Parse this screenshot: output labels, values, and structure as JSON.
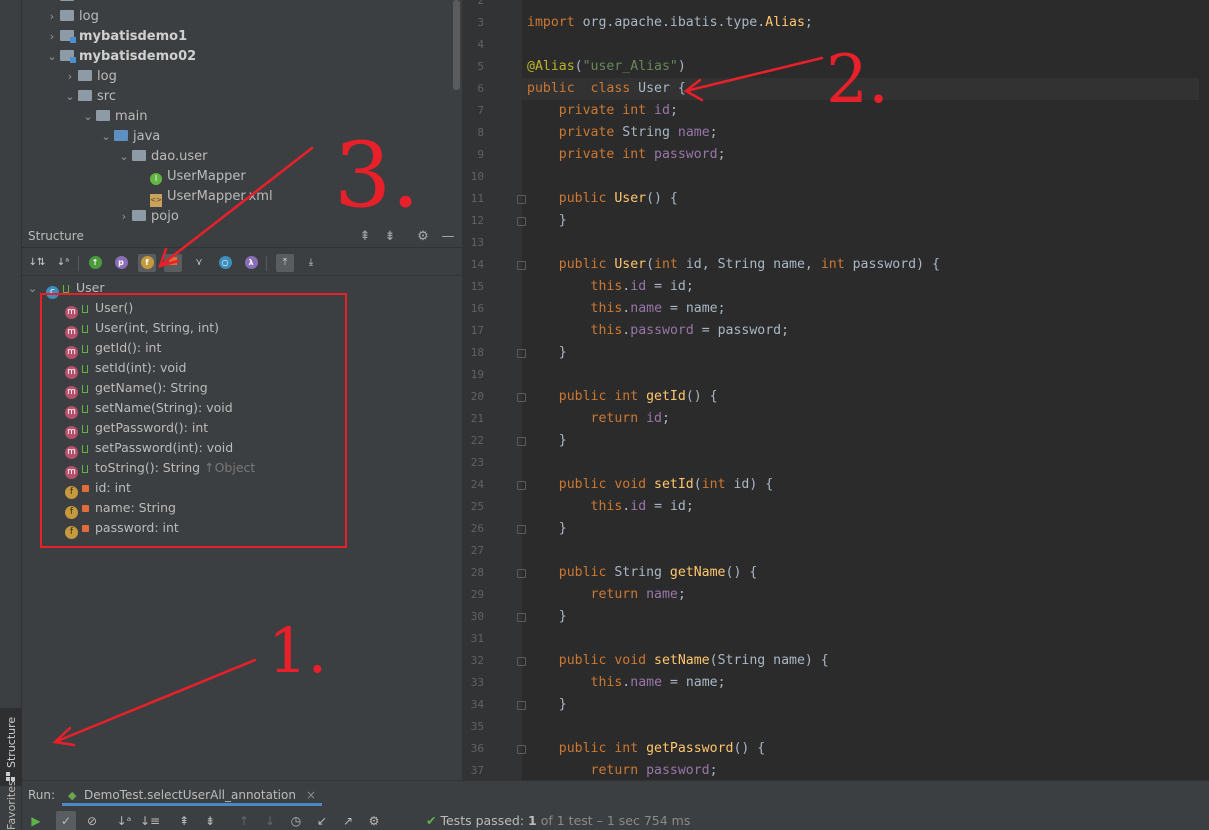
{
  "side_tabs": {
    "structure": "Structure",
    "favorites": "Favorites"
  },
  "project_tree": [
    {
      "label": "idea",
      "indent": 1,
      "chevron": "›",
      "icon": "folder"
    },
    {
      "label": "log",
      "indent": 1,
      "chevron": "›",
      "icon": "folder"
    },
    {
      "label": "mybatisdemo1",
      "indent": 1,
      "chevron": "›",
      "icon": "module",
      "bold": true
    },
    {
      "label": "mybatisdemo02",
      "indent": 1,
      "chevron": "⌄",
      "icon": "module",
      "bold": true
    },
    {
      "label": "log",
      "indent": 2,
      "chevron": "›",
      "icon": "folder"
    },
    {
      "label": "src",
      "indent": 2,
      "chevron": "⌄",
      "icon": "folder"
    },
    {
      "label": "main",
      "indent": 3,
      "chevron": "⌄",
      "icon": "folder"
    },
    {
      "label": "java",
      "indent": 4,
      "chevron": "⌄",
      "icon": "blue-folder"
    },
    {
      "label": "dao.user",
      "indent": 5,
      "chevron": "⌄",
      "icon": "folder"
    },
    {
      "label": "UserMapper",
      "indent": 6,
      "chevron": "",
      "icon": "interface"
    },
    {
      "label": "UserMapper.xml",
      "indent": 6,
      "chevron": "",
      "icon": "xml"
    },
    {
      "label": "pojo",
      "indent": 5,
      "chevron": "›",
      "icon": "folder"
    }
  ],
  "structure": {
    "title": "Structure",
    "root": "User",
    "members": [
      {
        "kind": "m",
        "access": "public",
        "label": "User()",
        "hint": ""
      },
      {
        "kind": "m",
        "access": "public",
        "label": "User(int, String, int)",
        "hint": ""
      },
      {
        "kind": "m",
        "access": "public",
        "label": "getId(): int",
        "hint": ""
      },
      {
        "kind": "m",
        "access": "public",
        "label": "setId(int): void",
        "hint": ""
      },
      {
        "kind": "m",
        "access": "public",
        "label": "getName(): String",
        "hint": ""
      },
      {
        "kind": "m",
        "access": "public",
        "label": "setName(String): void",
        "hint": ""
      },
      {
        "kind": "m",
        "access": "public",
        "label": "getPassword(): int",
        "hint": ""
      },
      {
        "kind": "m",
        "access": "public",
        "label": "setPassword(int): void",
        "hint": ""
      },
      {
        "kind": "m",
        "access": "public",
        "label": "toString(): String",
        "hint": "↑Object"
      },
      {
        "kind": "f",
        "access": "private",
        "label": "id: int",
        "hint": ""
      },
      {
        "kind": "f",
        "access": "private",
        "label": "name: String",
        "hint": ""
      },
      {
        "kind": "f",
        "access": "private",
        "label": "password: int",
        "hint": ""
      }
    ]
  },
  "editor": {
    "first_line": 2,
    "lines": [
      [],
      [
        [
          "kw",
          "import "
        ],
        [
          "pl",
          "org.apache.ibatis.type."
        ],
        [
          "fn",
          "Alias"
        ],
        [
          "pl",
          ";"
        ]
      ],
      [],
      [
        [
          "an",
          "@Alias"
        ],
        [
          "pl",
          "("
        ],
        [
          "st",
          "\"user_Alias\""
        ],
        [
          "pl",
          ")"
        ]
      ],
      [
        [
          "kw",
          "public  class "
        ],
        [
          "pl",
          "User "
        ],
        [
          "pl",
          "{"
        ]
      ],
      [
        [
          "pl",
          "    "
        ],
        [
          "kw",
          "private int "
        ],
        [
          "fd",
          "id"
        ],
        [
          "pl",
          ";"
        ]
      ],
      [
        [
          "pl",
          "    "
        ],
        [
          "kw",
          "private "
        ],
        [
          "pl",
          "String "
        ],
        [
          "fd",
          "name"
        ],
        [
          "pl",
          ";"
        ]
      ],
      [
        [
          "pl",
          "    "
        ],
        [
          "kw",
          "private int "
        ],
        [
          "fd",
          "password"
        ],
        [
          "pl",
          ";"
        ]
      ],
      [],
      [
        [
          "pl",
          "    "
        ],
        [
          "kw",
          "public "
        ],
        [
          "fn",
          "User"
        ],
        [
          "pl",
          "() {"
        ]
      ],
      [
        [
          "pl",
          "    }"
        ]
      ],
      [],
      [
        [
          "pl",
          "    "
        ],
        [
          "kw",
          "public "
        ],
        [
          "fn",
          "User"
        ],
        [
          "pl",
          "("
        ],
        [
          "kw",
          "int "
        ],
        [
          "pl",
          "id, String name, "
        ],
        [
          "kw",
          "int "
        ],
        [
          "pl",
          "password) {"
        ]
      ],
      [
        [
          "pl",
          "        "
        ],
        [
          "kw",
          "this"
        ],
        [
          "pl",
          "."
        ],
        [
          "fd",
          "id"
        ],
        [
          "pl",
          " = id;"
        ]
      ],
      [
        [
          "pl",
          "        "
        ],
        [
          "kw",
          "this"
        ],
        [
          "pl",
          "."
        ],
        [
          "fd",
          "name"
        ],
        [
          "pl",
          " = name;"
        ]
      ],
      [
        [
          "pl",
          "        "
        ],
        [
          "kw",
          "this"
        ],
        [
          "pl",
          "."
        ],
        [
          "fd",
          "password"
        ],
        [
          "pl",
          " = password;"
        ]
      ],
      [
        [
          "pl",
          "    }"
        ]
      ],
      [],
      [
        [
          "pl",
          "    "
        ],
        [
          "kw",
          "public int "
        ],
        [
          "fn",
          "getId"
        ],
        [
          "pl",
          "() {"
        ]
      ],
      [
        [
          "pl",
          "        "
        ],
        [
          "kw",
          "return "
        ],
        [
          "fd",
          "id"
        ],
        [
          "pl",
          ";"
        ]
      ],
      [
        [
          "pl",
          "    }"
        ]
      ],
      [],
      [
        [
          "pl",
          "    "
        ],
        [
          "kw",
          "public void "
        ],
        [
          "fn",
          "setId"
        ],
        [
          "pl",
          "("
        ],
        [
          "kw",
          "int "
        ],
        [
          "pl",
          "id) {"
        ]
      ],
      [
        [
          "pl",
          "        "
        ],
        [
          "kw",
          "this"
        ],
        [
          "pl",
          "."
        ],
        [
          "fd",
          "id"
        ],
        [
          "pl",
          " = id;"
        ]
      ],
      [
        [
          "pl",
          "    }"
        ]
      ],
      [],
      [
        [
          "pl",
          "    "
        ],
        [
          "kw",
          "public "
        ],
        [
          "pl",
          "String "
        ],
        [
          "fn",
          "getName"
        ],
        [
          "pl",
          "() {"
        ]
      ],
      [
        [
          "pl",
          "        "
        ],
        [
          "kw",
          "return "
        ],
        [
          "fd",
          "name"
        ],
        [
          "pl",
          ";"
        ]
      ],
      [
        [
          "pl",
          "    }"
        ]
      ],
      [],
      [
        [
          "pl",
          "    "
        ],
        [
          "kw",
          "public void "
        ],
        [
          "fn",
          "setName"
        ],
        [
          "pl",
          "(String name) {"
        ]
      ],
      [
        [
          "pl",
          "        "
        ],
        [
          "kw",
          "this"
        ],
        [
          "pl",
          "."
        ],
        [
          "fd",
          "name"
        ],
        [
          "pl",
          " = name;"
        ]
      ],
      [
        [
          "pl",
          "    }"
        ]
      ],
      [],
      [
        [
          "pl",
          "    "
        ],
        [
          "kw",
          "public int "
        ],
        [
          "fn",
          "getPassword"
        ],
        [
          "pl",
          "() {"
        ]
      ],
      [
        [
          "pl",
          "        "
        ],
        [
          "kw",
          "return "
        ],
        [
          "fd",
          "password"
        ],
        [
          "pl",
          ";"
        ]
      ]
    ],
    "fold_lines": [
      11,
      12,
      14,
      18,
      20,
      22,
      24,
      26,
      28,
      30,
      32,
      34,
      36
    ]
  },
  "run": {
    "label": "Run:",
    "tab": "DemoTest.selectUserAll_annotation",
    "status_prefix": "Tests passed:",
    "status_count": "1",
    "status_rest": "of 1 test – 1 sec 754 ms"
  },
  "annotations": {
    "one": "1.",
    "two": "2.",
    "three": "3."
  },
  "colors": {
    "annotation_red": "#e8202a",
    "accent_blue": "#4a88c7"
  }
}
